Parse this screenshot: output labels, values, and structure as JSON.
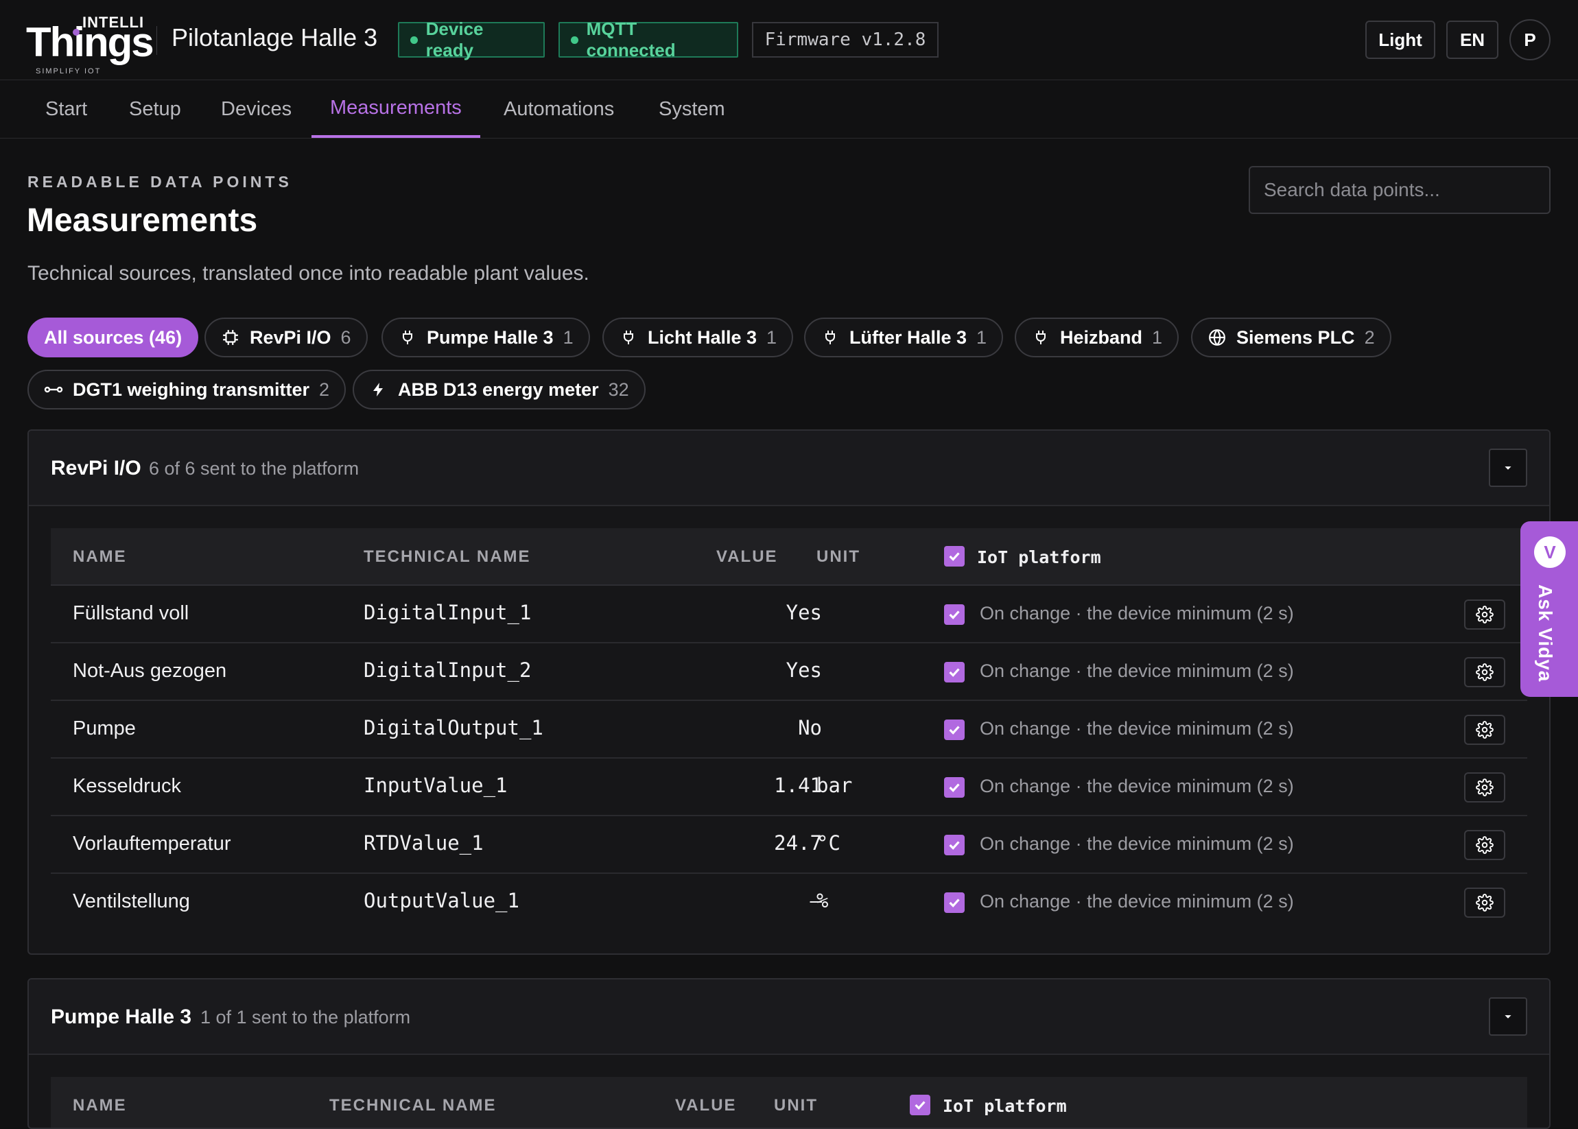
{
  "brand": {
    "intelli": "INTELLI",
    "things": "Things",
    "tagline": "SIMPLIFY IOT"
  },
  "header": {
    "device_name": "Pilotanlage Halle 3",
    "status_device": "Device ready",
    "status_mqtt": "MQTT connected",
    "firmware": "Firmware v1.2.8",
    "theme_button": "Light",
    "lang_button": "EN",
    "avatar_initial": "P"
  },
  "nav": {
    "tabs": [
      "Start",
      "Setup",
      "Devices",
      "Measurements",
      "Automations",
      "System"
    ],
    "active": "Measurements"
  },
  "page": {
    "eyebrow": "READABLE DATA POINTS",
    "title": "Measurements",
    "subtitle": "Technical sources, translated once into readable plant values.",
    "search_placeholder": "Search data points..."
  },
  "filters": [
    {
      "label": "All sources (46)",
      "count": "",
      "icon": "",
      "active": true
    },
    {
      "label": "RevPi I/O",
      "count": "6",
      "icon": "chip-icon"
    },
    {
      "label": "Pumpe Halle 3",
      "count": "1",
      "icon": "plug-icon"
    },
    {
      "label": "Licht Halle 3",
      "count": "1",
      "icon": "plug-icon"
    },
    {
      "label": "Lüfter Halle 3",
      "count": "1",
      "icon": "plug-icon"
    },
    {
      "label": "Heizband",
      "count": "1",
      "icon": "plug-icon"
    },
    {
      "label": "Siemens PLC",
      "count": "2",
      "icon": "globe-icon"
    },
    {
      "label": "DGT1 weighing transmitter",
      "count": "2",
      "icon": "link-icon"
    },
    {
      "label": "ABB D13 energy meter",
      "count": "32",
      "icon": "bolt-icon"
    }
  ],
  "columns": {
    "name": "NAME",
    "technical": "TECHNICAL NAME",
    "value": "VALUE",
    "unit": "UNIT",
    "platform": "IoT platform"
  },
  "sources": [
    {
      "title": "RevPi I/O",
      "meta": "6 of 6 sent to the platform",
      "rows": [
        {
          "name": "Füllstand voll",
          "technical": "DigitalInput_1",
          "value": "Yes",
          "unit": "",
          "platform": "On change · the device minimum (2 s)"
        },
        {
          "name": "Not-Aus gezogen",
          "technical": "DigitalInput_2",
          "value": "Yes",
          "unit": "",
          "platform": "On change · the device minimum (2 s)"
        },
        {
          "name": "Pumpe",
          "technical": "DigitalOutput_1",
          "value": "No",
          "unit": "",
          "platform": "On change · the device minimum (2 s)"
        },
        {
          "name": "Kesseldruck",
          "technical": "InputValue_1",
          "value": "1.41",
          "unit": "bar",
          "platform": "On change · the device minimum (2 s)"
        },
        {
          "name": "Vorlauftemperatur",
          "technical": "RTDValue_1",
          "value": "24.7",
          "unit": "°C",
          "platform": "On change · the device minimum (2 s)"
        },
        {
          "name": "Ventilstellung",
          "technical": "OutputValue_1",
          "value": "—",
          "unit": "%",
          "platform": "On change · the device minimum (2 s)"
        }
      ]
    },
    {
      "title": "Pumpe Halle 3",
      "meta": "1 of 1 sent to the platform"
    }
  ],
  "assistant": {
    "label": "Ask Vidya",
    "initial": "V"
  },
  "colors": {
    "accent": "#a65ad8",
    "status_ok": "#41c88a",
    "background": "#111112"
  }
}
